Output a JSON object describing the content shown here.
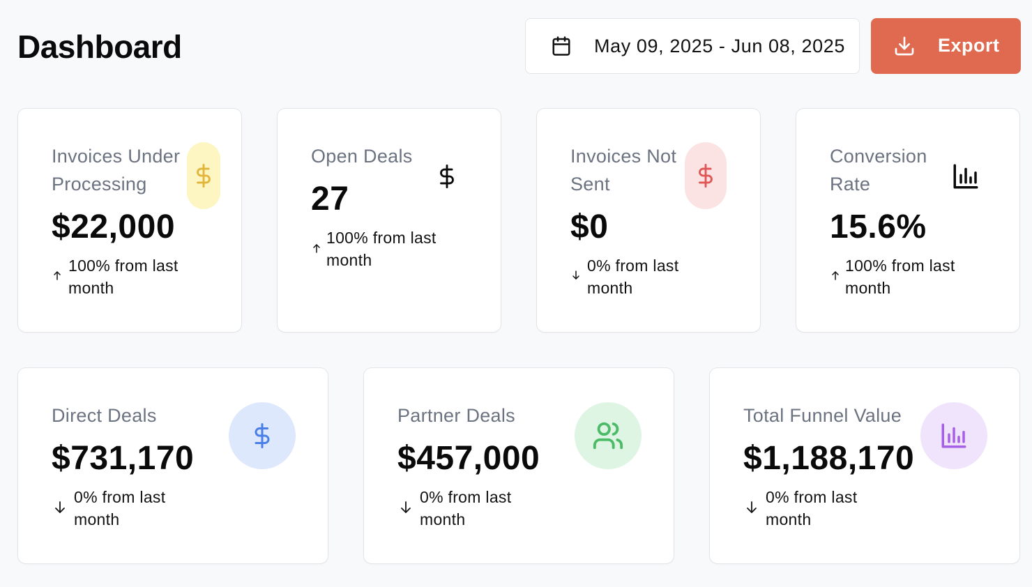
{
  "header": {
    "title": "Dashboard",
    "date_range": "May 09, 2025 - Jun 08, 2025",
    "export_label": "Export"
  },
  "colors": {
    "accent": "#df6a50",
    "yellow_badge": "#fdf6c3",
    "yellow_icon": "#e2b53a",
    "red_badge": "#fbe3e3",
    "red_icon": "#e05555",
    "blue_badge": "#dde8fc",
    "blue_icon": "#4a7fe8",
    "green_badge": "#dff5e4",
    "green_icon": "#4cbb68",
    "purple_badge": "#efe4fb",
    "purple_icon": "#a560e6"
  },
  "top_cards": [
    {
      "title": "Invoices Under Processing",
      "value": "$22,000",
      "change": "100% from last month",
      "trend": "up",
      "icon": "dollar-icon"
    },
    {
      "title": "Open Deals",
      "value": "27",
      "change": "100% from last month",
      "trend": "up",
      "icon": "dollar-icon"
    },
    {
      "title": "Invoices Not Sent",
      "value": "$0",
      "change": "0% from last month",
      "trend": "down",
      "icon": "dollar-icon"
    },
    {
      "title": "Conversion Rate",
      "value": "15.6%",
      "change": "100% from last month",
      "trend": "up",
      "icon": "bar-chart-icon"
    }
  ],
  "bottom_cards": [
    {
      "title": "Direct Deals",
      "value": "$731,170",
      "change": "0% from last month",
      "trend": "down",
      "icon": "dollar-icon"
    },
    {
      "title": "Partner Deals",
      "value": "$457,000",
      "change": "0% from last month",
      "trend": "down",
      "icon": "users-icon"
    },
    {
      "title": "Total Funnel Value",
      "value": "$1,188,170",
      "change": "0% from last month",
      "trend": "down",
      "icon": "bar-chart-icon"
    }
  ]
}
